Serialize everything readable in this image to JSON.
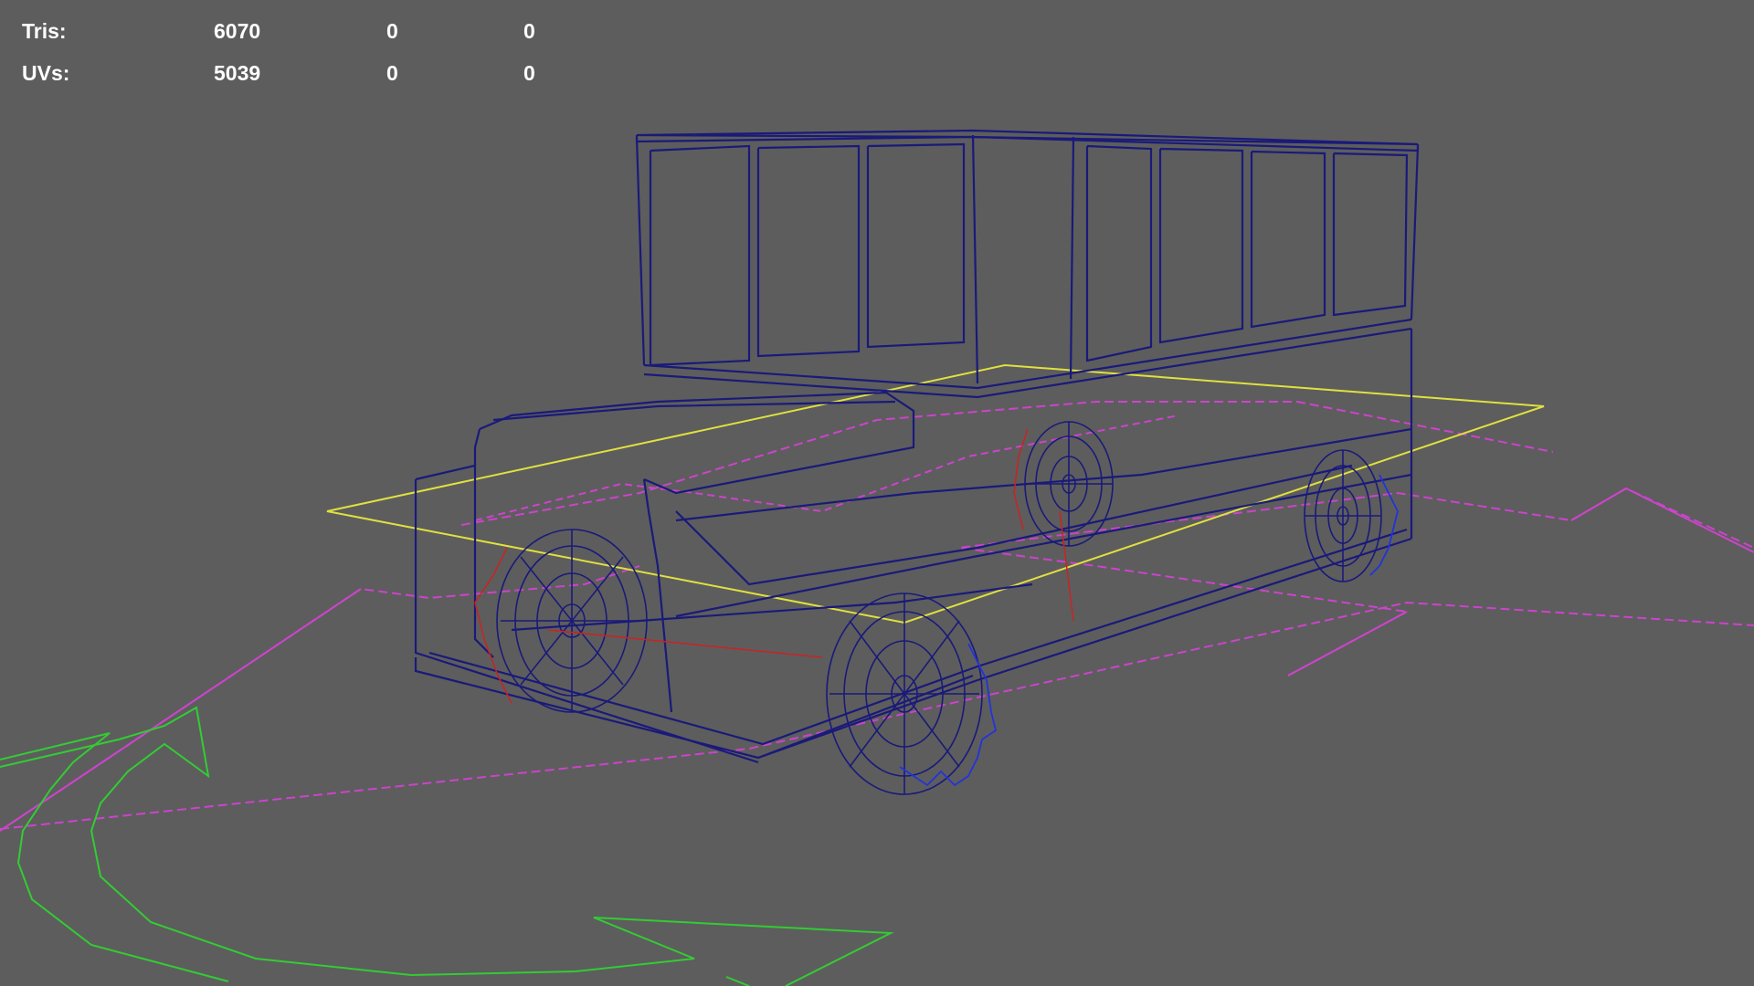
{
  "hud": {
    "rows": [
      {
        "label": "Tris:",
        "values": [
          "6070",
          "0",
          "0"
        ]
      },
      {
        "label": "UVs:",
        "values": [
          "5039",
          "0",
          "0"
        ]
      }
    ]
  },
  "colors": {
    "background": "#5d5d5d",
    "hud_text": "#ffffff",
    "wireframe": "#1a1a7a",
    "ground_plane": "#e0e040",
    "motion_path": "#cc44cc",
    "direction_arrow": "#33cc33",
    "joint_markers": "#cc2222",
    "wheel_spring": "#2233dd"
  },
  "icons": {
    "direction_arrow": "curved-arrow-icon"
  }
}
